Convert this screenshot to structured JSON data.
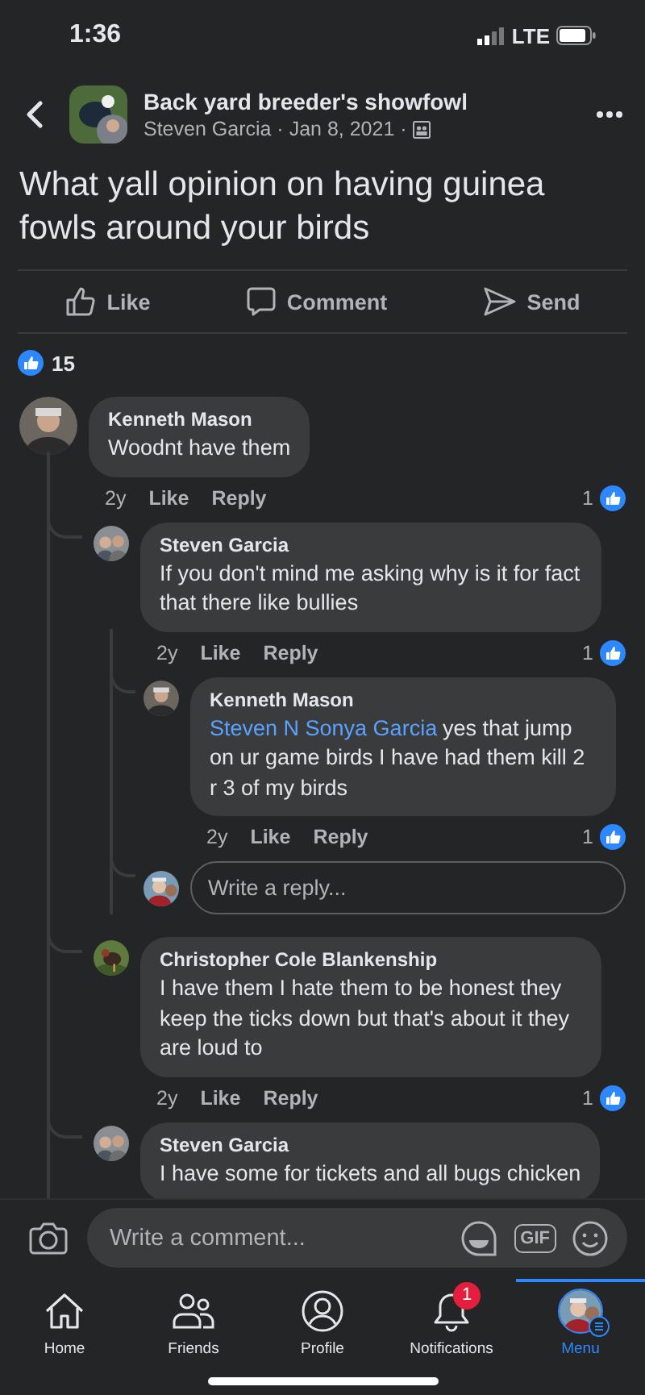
{
  "status_bar": {
    "time": "1:36",
    "network": "LTE"
  },
  "header": {
    "group": "Back yard breeder's showfowl",
    "meta": "Steven Garcia · Jan 8, 2021 ·"
  },
  "post": {
    "text": "What yall opinion on having guinea fowls around your birds"
  },
  "actions": [
    {
      "kind": "like",
      "label": "Like"
    },
    {
      "kind": "comment",
      "label": "Comment"
    },
    {
      "kind": "send",
      "label": "Send"
    }
  ],
  "reactions": {
    "count": "15"
  },
  "comments": [
    {
      "author": "Kenneth Mason",
      "text": "Woodnt have them",
      "age": "2y",
      "like": "Like",
      "reply": "Reply",
      "likes": "1",
      "children": [
        {
          "author": "Steven Garcia",
          "text": "If you don't mind me asking why is it for fact that there like bullies",
          "age": "2y",
          "like": "Like",
          "reply": "Reply",
          "likes": "1",
          "children": [
            {
              "author": "Kenneth Mason",
              "mention": "Steven N Sonya Garcia",
              "text": "yes that jump on ur game birds I have had them kill 2 r 3 of my birds",
              "age": "2y",
              "like": "Like",
              "reply": "Reply",
              "likes": "1"
            }
          ],
          "reply_field": {
            "placeholder": "Write a reply..."
          }
        },
        {
          "author": "Christopher Cole Blankenship",
          "text": "I have them I hate them to be honest they keep the ticks down but that's about it they are loud to",
          "age": "2y",
          "like": "Like",
          "reply": "Reply",
          "likes": "1"
        },
        {
          "author": "Steven Garcia",
          "text": "I have some for tickets and all bugs chicken"
        }
      ]
    }
  ],
  "composer": {
    "placeholder": "Write a comment...",
    "gif": "GIF"
  },
  "nav": [
    {
      "kind": "home",
      "label": "Home",
      "selected": false
    },
    {
      "kind": "friends",
      "label": "Friends",
      "selected": false
    },
    {
      "kind": "profile",
      "label": "Profile",
      "selected": false
    },
    {
      "kind": "notifications",
      "label": "Notifications",
      "selected": false,
      "badge": "1"
    },
    {
      "kind": "menu",
      "label": "Menu",
      "selected": true
    }
  ]
}
